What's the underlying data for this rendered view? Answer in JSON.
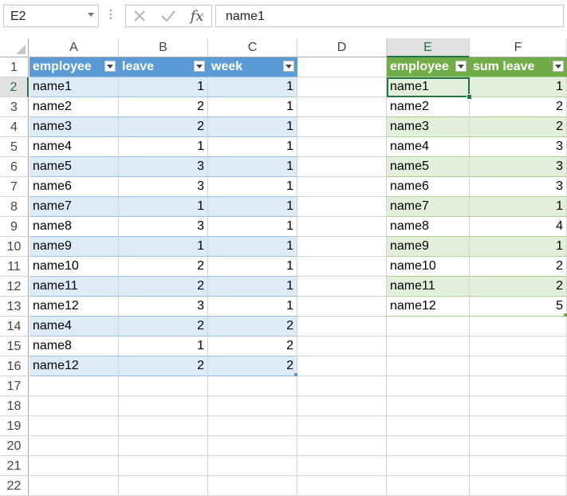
{
  "formula_bar": {
    "name_box": "E2",
    "cancel_icon": "x-icon",
    "enter_icon": "checkmark-icon",
    "function_label": "fx",
    "formula": "name1"
  },
  "columns": [
    "A",
    "B",
    "C",
    "D",
    "E",
    "F"
  ],
  "rows": [
    "1",
    "2",
    "3",
    "4",
    "5",
    "6",
    "7",
    "8",
    "9",
    "10",
    "11",
    "12",
    "13",
    "14",
    "15",
    "16",
    "17",
    "18",
    "19",
    "20",
    "21",
    "22"
  ],
  "active_cell": {
    "column": "E",
    "row": "2"
  },
  "table1": {
    "color": "#5b9bd5",
    "headers": [
      "employee",
      "leave",
      "week"
    ],
    "rows": [
      [
        "name1",
        "1",
        "1"
      ],
      [
        "name2",
        "2",
        "1"
      ],
      [
        "name3",
        "2",
        "1"
      ],
      [
        "name4",
        "1",
        "1"
      ],
      [
        "name5",
        "3",
        "1"
      ],
      [
        "name6",
        "3",
        "1"
      ],
      [
        "name7",
        "1",
        "1"
      ],
      [
        "name8",
        "3",
        "1"
      ],
      [
        "name9",
        "1",
        "1"
      ],
      [
        "name10",
        "2",
        "1"
      ],
      [
        "name11",
        "2",
        "1"
      ],
      [
        "name12",
        "3",
        "1"
      ],
      [
        "name4",
        "2",
        "2"
      ],
      [
        "name8",
        "1",
        "2"
      ],
      [
        "name12",
        "2",
        "2"
      ]
    ]
  },
  "table2": {
    "color": "#70ad47",
    "headers": [
      "employee",
      "sum leave"
    ],
    "rows": [
      [
        "name1",
        "1"
      ],
      [
        "name2",
        "2"
      ],
      [
        "name3",
        "2"
      ],
      [
        "name4",
        "3"
      ],
      [
        "name5",
        "3"
      ],
      [
        "name6",
        "3"
      ],
      [
        "name7",
        "1"
      ],
      [
        "name8",
        "4"
      ],
      [
        "name9",
        "1"
      ],
      [
        "name10",
        "2"
      ],
      [
        "name11",
        "2"
      ],
      [
        "name12",
        "5"
      ]
    ]
  }
}
